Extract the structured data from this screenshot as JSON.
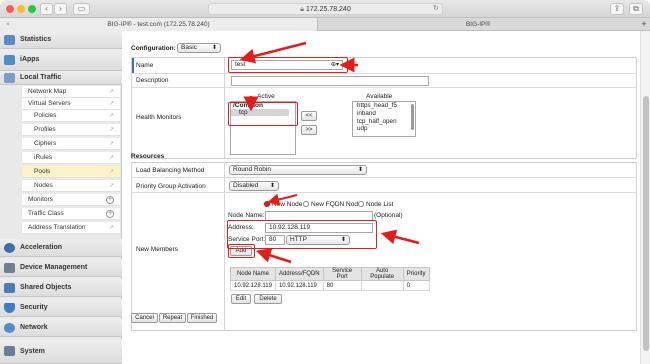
{
  "browser": {
    "url": "172.25.78.240",
    "tabs": [
      {
        "label": "BIG-IP® - test.com (172.25.78.240)"
      },
      {
        "label": "BIG-IP®"
      }
    ],
    "new_tab": "+"
  },
  "sidebar": {
    "sections_top": [
      {
        "label": "Statistics",
        "icon": "statistics-icon"
      },
      {
        "label": "iApps",
        "icon": "iapps-icon"
      },
      {
        "label": "Local Traffic",
        "icon": "local-traffic-icon"
      }
    ],
    "local_traffic_items": [
      {
        "label": "Network Map"
      },
      {
        "label": "Virtual Servers"
      },
      {
        "label": "Policies"
      },
      {
        "label": "Profiles"
      },
      {
        "label": "Ciphers"
      },
      {
        "label": "iRules"
      },
      {
        "label": "Pools"
      },
      {
        "label": "Nodes"
      },
      {
        "label": "Monitors"
      },
      {
        "label": "Traffic Class"
      },
      {
        "label": "Address Translation"
      }
    ],
    "sections_bottom": [
      {
        "label": "Acceleration",
        "icon": "acceleration-icon"
      },
      {
        "label": "Device Management",
        "icon": "device-management-icon"
      },
      {
        "label": "Shared Objects",
        "icon": "shared-objects-icon"
      },
      {
        "label": "Security",
        "icon": "security-icon"
      },
      {
        "label": "Network",
        "icon": "network-icon"
      },
      {
        "label": "System",
        "icon": "system-icon"
      }
    ]
  },
  "form": {
    "configuration_label": "Configuration:",
    "configuration_value": "Basic",
    "name_label": "Name",
    "name_value": "test",
    "description_label": "Description",
    "description_value": "",
    "health_monitors_label": "Health Monitors",
    "active_label": "Active",
    "available_label": "Available",
    "active_group": "/Common",
    "active_items": [
      "tcp"
    ],
    "available_items": [
      "https_head_f5",
      "inband",
      "tcp_half_open",
      "udp"
    ],
    "move_left": "<<",
    "move_right": ">>"
  },
  "resources": {
    "header": "Resources",
    "lb_label": "Load Balancing Method",
    "lb_value": "Round Robin",
    "pga_label": "Priority Group Activation",
    "pga_value": "Disabled",
    "members_label": "New Members",
    "radio_new_node": "New Node",
    "radio_new_fqdn": "New FQDN Node",
    "radio_node_list": "Node List",
    "node_name_label": "Node Name:",
    "node_name_optional": "(Optional)",
    "address_label": "Address:",
    "address_value": "10.92.128.119",
    "service_port_label": "Service Port:",
    "service_port_value": "80",
    "service_select": "HTTP",
    "add_button": "Add",
    "table_headers": [
      "Node Name",
      "Address/FQDN",
      "Service Port",
      "Auto Populate",
      "Priority"
    ],
    "table_rows": [
      [
        "10.92.128.119",
        "10.92.128.119",
        "80",
        "",
        "0"
      ]
    ],
    "edit_button": "Edit",
    "delete_button": "Delete"
  },
  "footer": {
    "cancel": "Cancel",
    "repeat": "Repeat",
    "finished": "Finished"
  },
  "colors": {
    "annotation_red": "#e31c1c",
    "selected_pool": "#fbf3c6"
  }
}
